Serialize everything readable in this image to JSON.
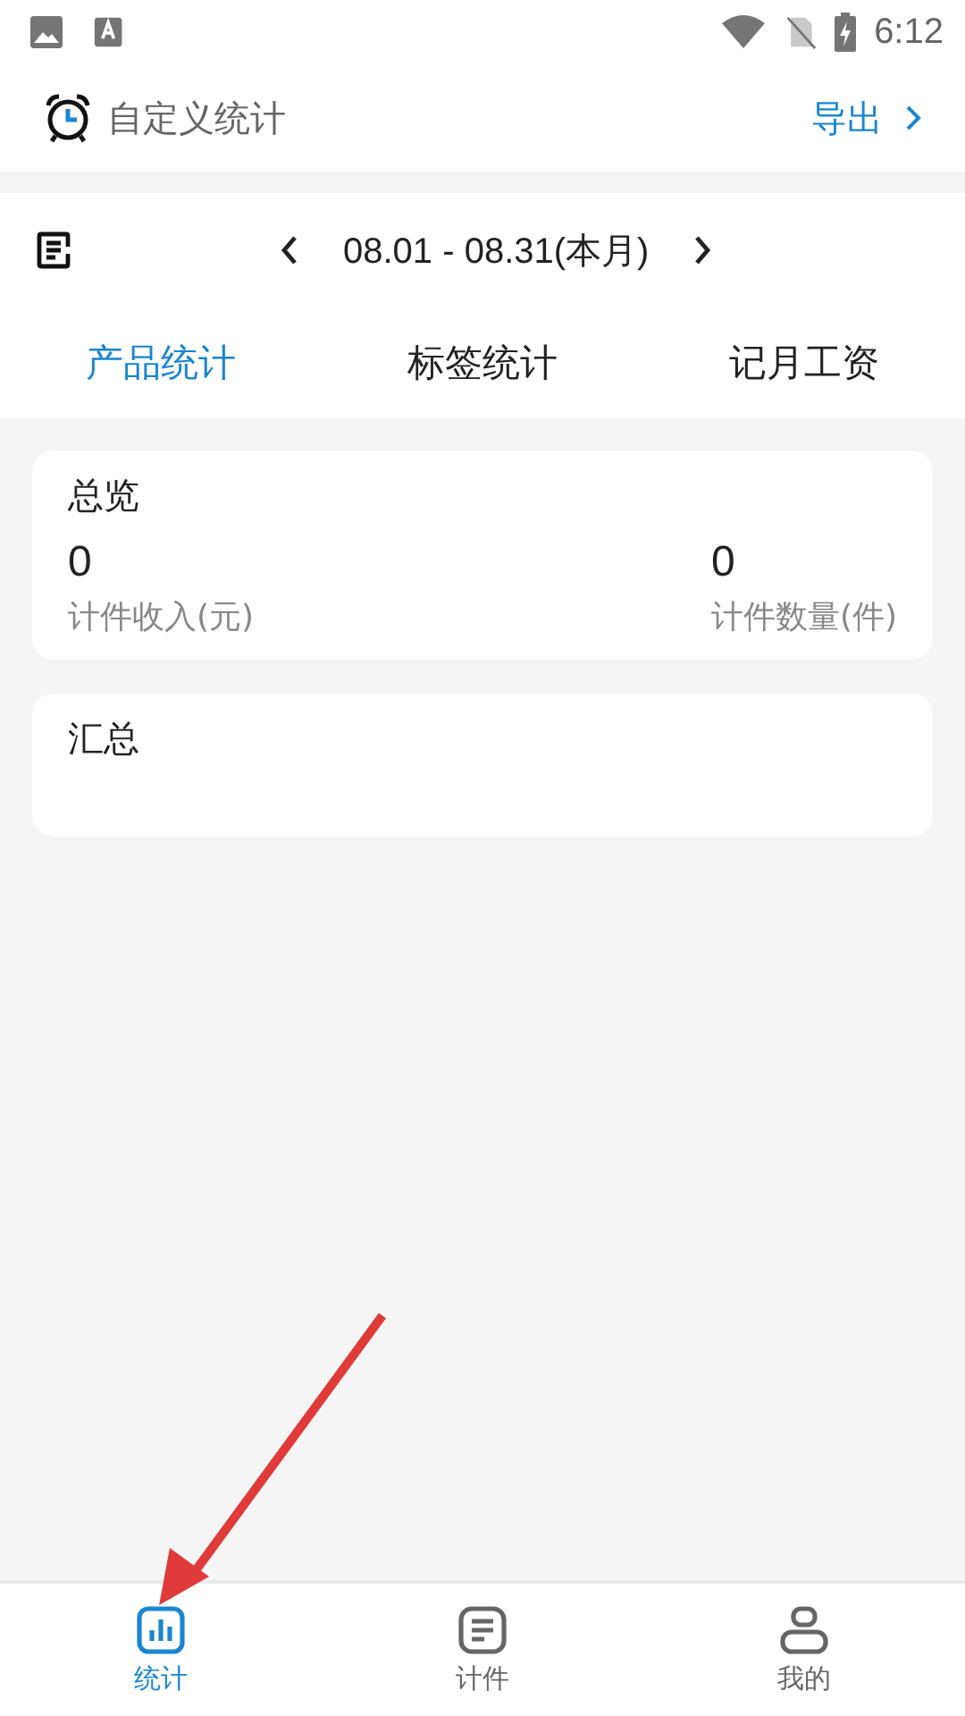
{
  "status_bar": {
    "time": "6:12"
  },
  "header": {
    "title": "自定义统计",
    "export": "导出"
  },
  "date_range": {
    "label": "08.01 - 08.31(本月)"
  },
  "tabs": [
    {
      "label": "产品统计",
      "selected": true
    },
    {
      "label": "标签统计",
      "selected": false
    },
    {
      "label": "记月工资",
      "selected": false
    }
  ],
  "overview": {
    "title": "总览",
    "stats": [
      {
        "value": "0",
        "label": "计件收入(元)"
      },
      {
        "value": "0",
        "label": "计件数量(件)"
      }
    ]
  },
  "summary": {
    "title": "汇总"
  },
  "bottom_nav": [
    {
      "kind": "chart",
      "label": "统计",
      "selected": true
    },
    {
      "kind": "list",
      "label": "计件",
      "selected": false
    },
    {
      "kind": "person",
      "label": "我的",
      "selected": false
    }
  ]
}
